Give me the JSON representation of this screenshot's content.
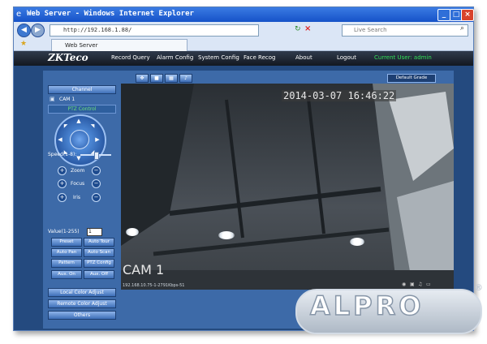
{
  "browser": {
    "title": "Web Server - Windows Internet Explorer",
    "address": "http://192.168.1.88/",
    "search_placeholder": "Live Search",
    "tab_label": "Web Server"
  },
  "app": {
    "logo": "ZKTeco",
    "menu": [
      "Record Query",
      "Alarm Config",
      "System Config",
      "Face Recog",
      "About",
      "Logout"
    ],
    "current_user": "Current User: admin"
  },
  "panel": {
    "channel_button": "Channel",
    "camera_item": "CAM 1",
    "ptz_label": "PTZ Control",
    "speed_label": "Speed(1-8):",
    "speed_level": 0.5,
    "zoom_label": "Zoom",
    "focus_label": "Focus",
    "iris_label": "Iris",
    "value_label": "Value(1-255)",
    "value": "1",
    "buttons": [
      "Preset",
      "Auto Tour",
      "Auto Pan",
      "Auto Scan",
      "Pattern",
      "PTZ Config",
      "Aux. On",
      "Aux. Off"
    ],
    "local_color": "Local Color Adjust",
    "remote_color": "Remote Color Adjust",
    "others": "Others"
  },
  "video": {
    "default_grade": "Default Grade",
    "timestamp": "2014-03-07 16:46:22",
    "cam_label": "CAM 1",
    "stream_info": "192.168.10.75-1-2791Kbps-51"
  },
  "watermark": {
    "text": "ALPRO",
    "reg": "®"
  },
  "colors": {
    "titlebar": "#1652c8",
    "page_bg": "#244a7f",
    "accent_green": "#6fe07a"
  }
}
